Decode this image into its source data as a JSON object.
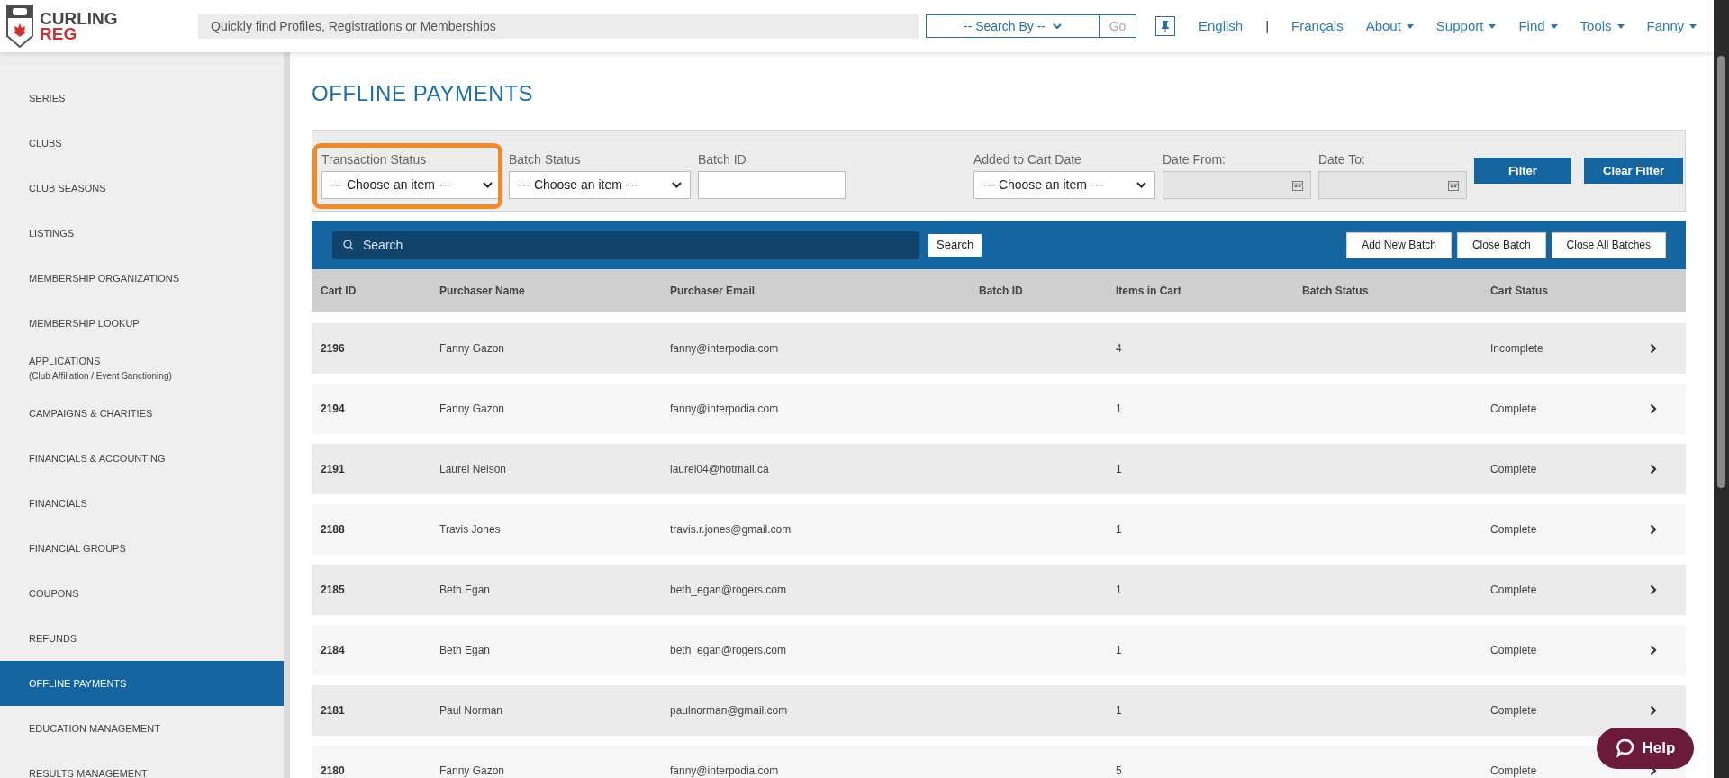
{
  "header": {
    "logo": [
      "CURLING",
      "REG"
    ],
    "search": {
      "placeholder": "Quickly find Profiles, Registrations or Memberships"
    },
    "search_by": "-- Search By --",
    "go": "Go",
    "nav": [
      {
        "label": "English",
        "kind": "link"
      },
      {
        "label": "|",
        "kind": "separator"
      },
      {
        "label": "Français",
        "kind": "link"
      },
      {
        "label": "About",
        "kind": "menu"
      },
      {
        "label": "Support",
        "kind": "menu"
      },
      {
        "label": "Find",
        "kind": "menu"
      },
      {
        "label": "Tools",
        "kind": "menu"
      },
      {
        "label": "Fanny",
        "kind": "menu"
      }
    ]
  },
  "sidebar": {
    "items": [
      {
        "label": "SERIES",
        "selected": false
      },
      {
        "label": "CLUBS",
        "selected": false
      },
      {
        "label": "CLUB SEASONS",
        "selected": false
      },
      {
        "label": "LISTINGS",
        "selected": false
      },
      {
        "label": "MEMBERSHIP ORGANIZATIONS",
        "selected": false
      },
      {
        "label": "MEMBERSHIP LOOKUP",
        "selected": false
      },
      {
        "label": "APPLICATIONS",
        "note": "(Club Affiliation / Event Sanctioning)",
        "selected": false
      },
      {
        "label": "CAMPAIGNS & CHARITIES",
        "selected": false
      },
      {
        "label": "FINANCIALS & ACCOUNTING",
        "selected": false
      },
      {
        "label": "FINANCIALS",
        "selected": false
      },
      {
        "label": "FINANCIAL GROUPS",
        "selected": false
      },
      {
        "label": "COUPONS",
        "selected": false
      },
      {
        "label": "REFUNDS",
        "selected": false
      },
      {
        "label": "OFFLINE PAYMENTS",
        "selected": true
      },
      {
        "label": "EDUCATION MANAGEMENT",
        "selected": false
      },
      {
        "label": "RESULTS MANAGEMENT",
        "selected": false
      }
    ]
  },
  "page_title": "OFFLINE PAYMENTS",
  "filters": [
    {
      "kind": "select",
      "label": "Transaction Status",
      "value": "--- Choose an item ---",
      "highlighted": true
    },
    {
      "kind": "select",
      "label": "Batch Status",
      "value": "--- Choose an item ---",
      "highlighted": false
    },
    {
      "kind": "text",
      "label": "Batch ID",
      "highlighted": false
    },
    {
      "kind": "gap"
    },
    {
      "kind": "select",
      "label": "Added to Cart Date",
      "value": "--- Choose an item ---",
      "highlighted": false
    },
    {
      "kind": "date",
      "label": "Date From:",
      "highlighted": false
    },
    {
      "kind": "date",
      "label": "Date To:",
      "highlighted": false
    }
  ],
  "filter_buttons": [
    "Filter",
    "Clear Filter"
  ],
  "toolbar": {
    "search": {
      "placeholder": "Search"
    },
    "search_button": "Search",
    "actions": [
      "Add New Batch",
      "Close Batch",
      "Close All Batches"
    ]
  },
  "table": {
    "columns": [
      "Cart ID",
      "Purchaser Name",
      "Purchaser Email",
      "Batch ID",
      "Items in Cart",
      "Batch Status",
      "Cart Status"
    ],
    "rows": [
      [
        "2196",
        "Fanny Gazon",
        "fanny@interpodia.com",
        "",
        "4",
        "",
        "Incomplete"
      ],
      [
        "2194",
        "Fanny Gazon",
        "fanny@interpodia.com",
        "",
        "1",
        "",
        "Complete"
      ],
      [
        "2191",
        "Laurel Nelson",
        "laurel04@hotmail.ca",
        "",
        "1",
        "",
        "Complete"
      ],
      [
        "2188",
        "Travis Jones",
        "travis.r.jones@gmail.com",
        "",
        "1",
        "",
        "Complete"
      ],
      [
        "2185",
        "Beth Egan",
        "beth_egan@rogers.com",
        "",
        "1",
        "",
        "Complete"
      ],
      [
        "2184",
        "Beth Egan",
        "beth_egan@rogers.com",
        "",
        "1",
        "",
        "Complete"
      ],
      [
        "2181",
        "Paul Norman",
        "paulnorman@gmail.com",
        "",
        "1",
        "",
        "Complete"
      ],
      [
        "2180",
        "Fanny Gazon",
        "fanny@interpodia.com",
        "",
        "5",
        "",
        "Complete"
      ]
    ]
  },
  "help_button": "Help"
}
